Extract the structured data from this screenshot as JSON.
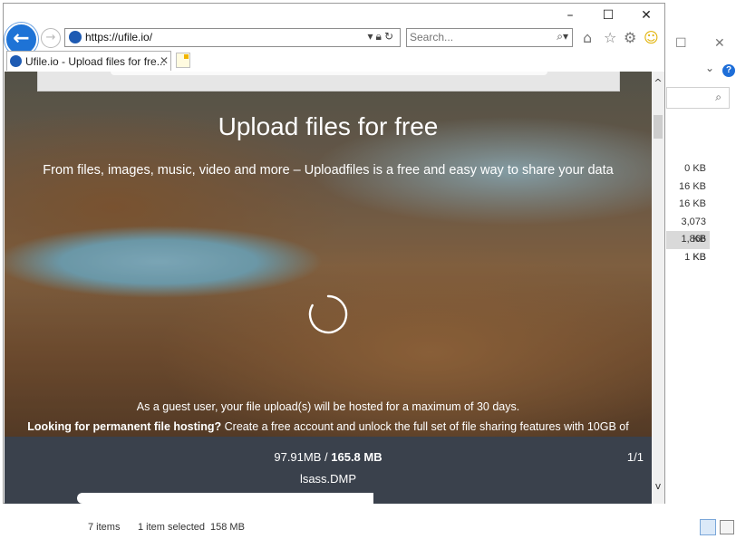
{
  "explorer": {
    "sizes": [
      "0 KB",
      "16 KB",
      "16 KB",
      "3,073 KB",
      "1,866 KB",
      "1 KB"
    ],
    "selected_size_index": 4,
    "status_items": "7 items",
    "status_selected": "1 item selected",
    "status_size": "158 MB",
    "icons": {
      "maximize": "square-icon",
      "close": "x-icon",
      "help": "help-icon",
      "search": "search-icon"
    },
    "help_glyph": "?"
  },
  "browser": {
    "window_buttons": {
      "minimize": "–",
      "maximize": "☐",
      "close": "✕"
    },
    "url": "https://ufile.io/",
    "search_placeholder": "Search...",
    "tab_title": "Ufile.io - Upload files for fre...",
    "accent": "#1e73d6"
  },
  "page": {
    "hero_title": "Upload files for free",
    "hero_subtitle": "From files, images, music, video and more – Uploadfiles is a free and easy way to share your data",
    "guest_note": "As a guest user, your file upload(s) will be hosted for a maximum of 30 days.",
    "permanent_note_bold": "Looking for permanent file hosting?",
    "permanent_note_rest": " Create a free account and unlock the full set of file sharing features with 10GB of",
    "upload": {
      "uploaded": "97.91MB",
      "separator": " / ",
      "total": "165.8 MB",
      "file_name": "lsass.DMP",
      "file_count": "1/1",
      "progress_fraction": 0.59
    }
  }
}
